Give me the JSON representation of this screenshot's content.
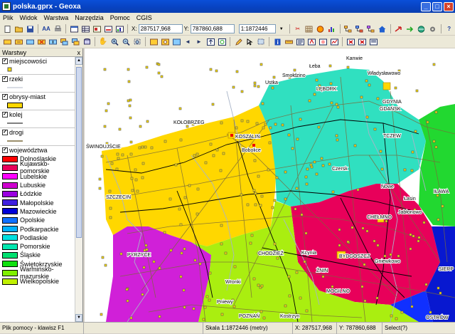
{
  "window": {
    "title": "polska.gprx - Geoxa"
  },
  "menu": [
    "Plik",
    "Widok",
    "Warstwa",
    "Narzędzia",
    "Pomoc",
    "CGIS"
  ],
  "toolbar": {
    "x_label": "X:",
    "x_value": "287517,968",
    "y_label": "Y:",
    "y_value": "787860,688",
    "scale_value": "1:1872446"
  },
  "panel": {
    "title": "Warstwy",
    "close": "x"
  },
  "layers": [
    {
      "name": "miejscowości",
      "checked": "✓"
    },
    {
      "name": "rzeki",
      "checked": "✓"
    },
    {
      "name": "obrysy-miast",
      "checked": "✓"
    },
    {
      "name": "kolej",
      "checked": "✓"
    },
    {
      "name": "drogi",
      "checked": "✓"
    },
    {
      "name": "województwa",
      "checked": "✓"
    }
  ],
  "voivodeships": [
    {
      "name": "Dolnośląskie",
      "color": "#ff0000"
    },
    {
      "name": "Kujawsko-pomorskie",
      "color": "#e8005a"
    },
    {
      "name": "Lubelskie",
      "color": "#ff00ff"
    },
    {
      "name": "Lubuskie",
      "color": "#d000d0"
    },
    {
      "name": "Łódzkie",
      "color": "#9a00e0"
    },
    {
      "name": "Małopolskie",
      "color": "#4020e0"
    },
    {
      "name": "Mazowieckie",
      "color": "#0000d8"
    },
    {
      "name": "Opolskie",
      "color": "#1070ff"
    },
    {
      "name": "Podkarpackie",
      "color": "#00b0ff"
    },
    {
      "name": "Podlaskie",
      "color": "#00e0e0"
    },
    {
      "name": "Pomorskie",
      "color": "#00e8b0"
    },
    {
      "name": "Śląskie",
      "color": "#00e070"
    },
    {
      "name": "Świętokrzyskie",
      "color": "#10e010"
    },
    {
      "name": "Warmińsko-mazurskie",
      "color": "#80f000"
    },
    {
      "name": "Wielkopolskie",
      "color": "#c0f000"
    }
  ],
  "map_labels": [
    "Kanwie",
    "Łeba",
    "Władysławowo",
    "Smołdzino",
    "Ustka",
    "LĘBORK",
    "GDYNIA",
    "GDAŃSK",
    "KOŁOBRZEG",
    "KOSZALIN",
    "Bobolice",
    "ŚWINOUJŚCIE",
    "TCZEW",
    "Czersk",
    "Nowe",
    "SZCZECIN",
    "Łasin",
    "IŁAWA",
    "CHEŁMNO",
    "Jabłonowo",
    "PYRZYCE",
    "CHODZIEŻ",
    "Kcynia",
    "BYDGOSZCZ",
    "Gniewkowo",
    "ŻNIN",
    "Wronki",
    "MOGILNO",
    "Pniewy",
    "POZNAŃ",
    "Kostrzyn",
    "OSTRÓW",
    "SIERP"
  ],
  "status": {
    "help": "Plik pomocy - klawisz F1",
    "scale": "Skala 1:1872446 (metry)",
    "x": "X: 287517,968",
    "y": "Y: 787860,688",
    "select": "Select(?)"
  }
}
